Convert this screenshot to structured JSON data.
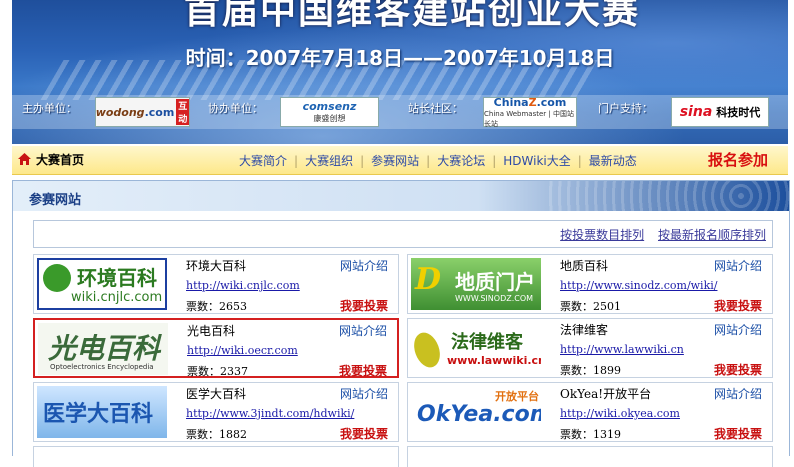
{
  "banner": {
    "title": "首届中国维客建站创业大赛",
    "time": "时间：2007年7月18日——2007年10月18日",
    "sponsors": [
      {
        "label": "主办单位：",
        "logo": "wodong.com 互动"
      },
      {
        "label": "协办单位：",
        "logo": "comsenz 康盛创想"
      },
      {
        "label": "站长社区：",
        "logo": "China Z.com"
      },
      {
        "label": "门户支持：",
        "logo": "sina 科技时代"
      }
    ]
  },
  "nav": {
    "home": "大赛首页",
    "links": [
      "大赛简介",
      "大赛组织",
      "参赛网站",
      "大赛论坛",
      "HDWiki大全",
      "最新动态"
    ],
    "signup": "报名参加"
  },
  "panel": {
    "title": "参赛网站",
    "sort_links": [
      "按投票数目排列",
      "按最新报名顺序排列"
    ]
  },
  "sites": [
    {
      "name": "环境大百科",
      "url": "http://wiki.cnjlc.com",
      "votes": "票数：2653",
      "intro": "网站介绍",
      "vote": "我要投票",
      "logo_text": "环境百科",
      "logo_sub": "wiki.cnjlc.com"
    },
    {
      "name": "地质百科",
      "url": "http://www.sinodz.com/wiki/",
      "votes": "票数：2501",
      "intro": "网站介绍",
      "vote": "我要投票",
      "logo_text": "地质门户",
      "logo_sub": "WWW.SINODZ.COM"
    },
    {
      "name": "光电百科",
      "url": "http://wiki.oecr.com",
      "votes": "票数：2337",
      "intro": "网站介绍",
      "vote": "我要投票",
      "logo_text": "光电百科",
      "logo_sub": "Optoelectronics Encyclopedia"
    },
    {
      "name": "法律维客",
      "url": "http://www.lawwiki.cn",
      "votes": "票数：1899",
      "intro": "网站介绍",
      "vote": "我要投票",
      "logo_text": "法律维客",
      "logo_sub": "www.lawwiki.cn"
    },
    {
      "name": "医学大百科",
      "url": "http://www.3jindt.com/hdwiki/",
      "votes": "票数：1882",
      "intro": "网站介绍",
      "vote": "我要投票",
      "logo_text": "医学大百科",
      "logo_sub": ""
    },
    {
      "name": "OkYea!开放平台",
      "url": "http://wiki.okyea.com",
      "votes": "票数：1319",
      "intro": "网站介绍",
      "vote": "我要投票",
      "logo_text": "OkYea.com",
      "logo_sub": "开放平台"
    }
  ]
}
